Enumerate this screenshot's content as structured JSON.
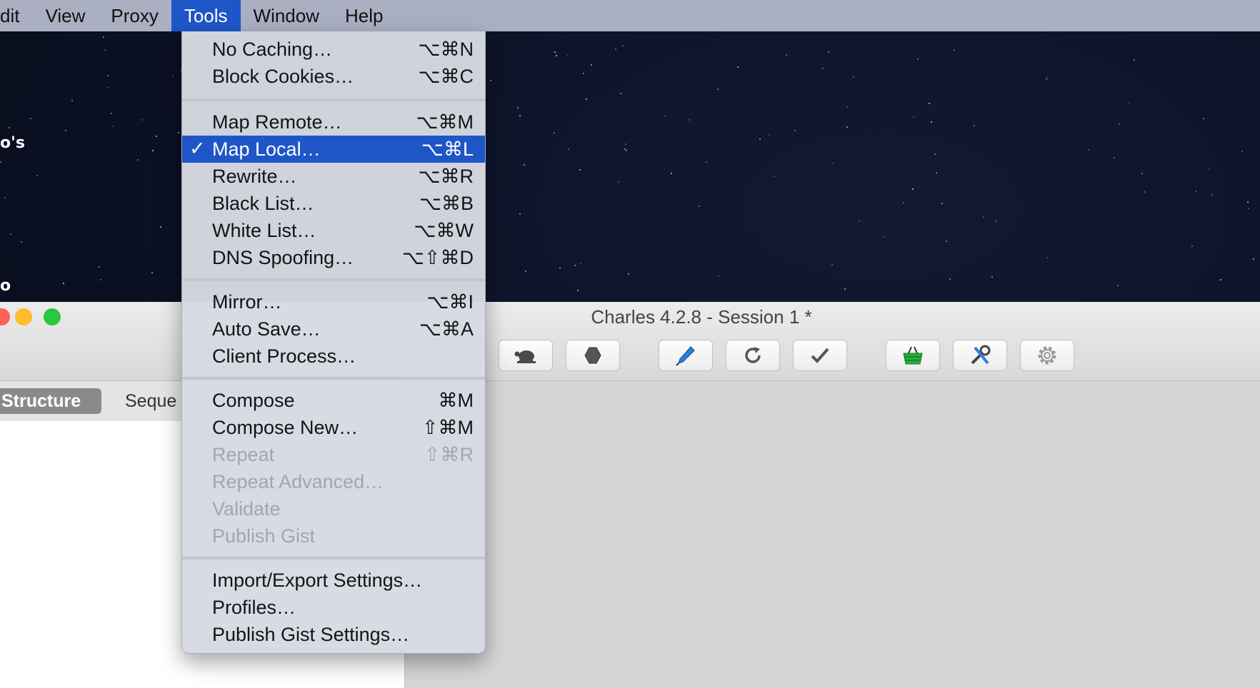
{
  "menubar": {
    "items": [
      "dit",
      "View",
      "Proxy",
      "Tools",
      "Window",
      "Help"
    ],
    "active": "Tools"
  },
  "desktop": {
    "label_top": "o's",
    "label_bottom": "o"
  },
  "window": {
    "title": "Charles 4.2.8 - Session 1 *",
    "tabs": {
      "structure": "Structure",
      "sequence": "Seque"
    },
    "toolbar_icons": [
      "turtle-icon",
      "stop-icon",
      "pen-icon",
      "refresh-icon",
      "checkmark-icon",
      "basket-icon",
      "tools-icon",
      "gear-icon"
    ]
  },
  "tools_menu": {
    "groups": [
      [
        {
          "label": "No Caching…",
          "shortcut": "⌥⌘N"
        },
        {
          "label": "Block Cookies…",
          "shortcut": "⌥⌘C"
        }
      ],
      [
        {
          "label": "Map Remote…",
          "shortcut": "⌥⌘M"
        },
        {
          "label": "Map Local…",
          "shortcut": "⌥⌘L",
          "checked": true,
          "highlighted": true
        },
        {
          "label": "Rewrite…",
          "shortcut": "⌥⌘R"
        },
        {
          "label": "Black List…",
          "shortcut": "⌥⌘B"
        },
        {
          "label": "White List…",
          "shortcut": "⌥⌘W"
        },
        {
          "label": "DNS Spoofing…",
          "shortcut": "⌥⇧⌘D"
        }
      ],
      [
        {
          "label": "Mirror…",
          "shortcut": "⌥⌘I"
        },
        {
          "label": "Auto Save…",
          "shortcut": "⌥⌘A"
        },
        {
          "label": "Client Process…",
          "shortcut": ""
        }
      ],
      [
        {
          "label": "Compose",
          "shortcut": "⌘M"
        },
        {
          "label": "Compose New…",
          "shortcut": "⇧⌘M"
        },
        {
          "label": "Repeat",
          "shortcut": "⇧⌘R",
          "disabled": true
        },
        {
          "label": "Repeat Advanced…",
          "shortcut": "",
          "disabled": true
        },
        {
          "label": "Validate",
          "shortcut": "",
          "disabled": true
        },
        {
          "label": "Publish Gist",
          "shortcut": "",
          "disabled": true
        }
      ],
      [
        {
          "label": "Import/Export Settings…",
          "shortcut": ""
        },
        {
          "label": "Profiles…",
          "shortcut": ""
        },
        {
          "label": "Publish Gist Settings…",
          "shortcut": ""
        }
      ]
    ],
    "check_mark": "✓"
  },
  "colors": {
    "highlight": "#1f56c7",
    "close": "#fe5f57",
    "minimize": "#febc2e",
    "zoom": "#28c840"
  }
}
